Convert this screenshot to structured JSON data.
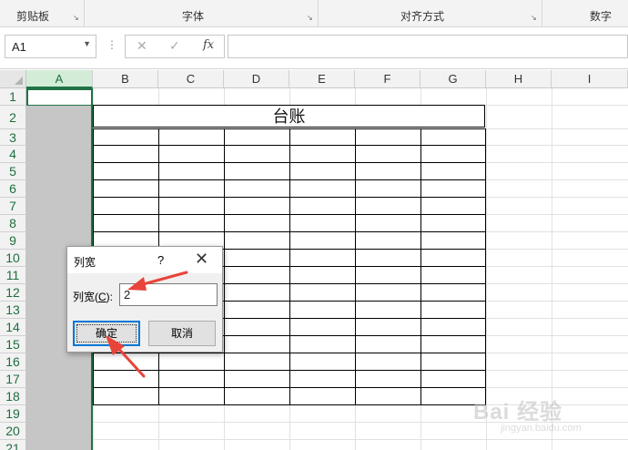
{
  "ribbon": {
    "groups": [
      {
        "label": "剪贴板"
      },
      {
        "label": "字体"
      },
      {
        "label": "对齐方式"
      },
      {
        "label": "数字"
      }
    ]
  },
  "formula_bar": {
    "name_box": "A1",
    "cancel_icon": "close-icon",
    "enter_icon": "check-icon",
    "fx_label": "fx",
    "formula_value": ""
  },
  "grid": {
    "columns": [
      "A",
      "B",
      "C",
      "D",
      "E",
      "F",
      "G",
      "H",
      "I"
    ],
    "rows": [
      "1",
      "2",
      "3",
      "4",
      "5",
      "6",
      "7",
      "8",
      "9",
      "10",
      "11",
      "12",
      "13",
      "14",
      "15",
      "16",
      "17",
      "18",
      "19",
      "20",
      "21"
    ],
    "selected_column": "A",
    "selected_cell": "A1",
    "title_cell": "台账"
  },
  "dialog": {
    "title": "列宽",
    "help": "?",
    "close_icon": "close-icon",
    "label": "列宽(",
    "label_access_key": "C",
    "label_suffix": "):",
    "value": "2",
    "ok_label": "确定",
    "cancel_label": "取消"
  },
  "annotations": {
    "arrow_color": "#e8443a"
  },
  "watermark": {
    "main": "Bai 经验",
    "sub": "jingyan.baidu.com"
  },
  "colors": {
    "selection_green": "#217346",
    "header_selected_bg": "#d3ecd8",
    "column_selected_bg": "#c6c6c6",
    "dialog_default_button": "#0078d7"
  }
}
